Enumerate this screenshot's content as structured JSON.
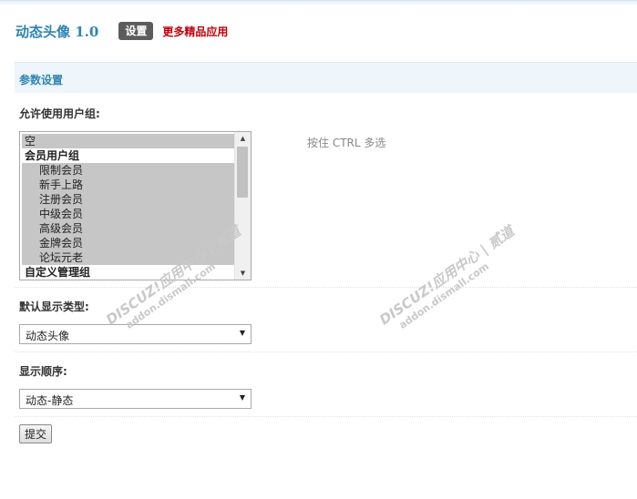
{
  "header": {
    "app_title": "动态头像 1.0",
    "settings_label": "设置",
    "more_apps_label": "更多精品应用"
  },
  "section": {
    "title": "参数设置"
  },
  "user_groups": {
    "label": "允许使用用户组:",
    "hint": "按住 CTRL 多选",
    "options": [
      {
        "text": "空",
        "group": false,
        "selected": true
      },
      {
        "text": "会员用户组",
        "group": true,
        "selected": false
      },
      {
        "text": "限制会员",
        "group": false,
        "selected": true
      },
      {
        "text": "新手上路",
        "group": false,
        "selected": true
      },
      {
        "text": "注册会员",
        "group": false,
        "selected": true
      },
      {
        "text": "中级会员",
        "group": false,
        "selected": true
      },
      {
        "text": "高级会员",
        "group": false,
        "selected": true
      },
      {
        "text": "金牌会员",
        "group": false,
        "selected": true
      },
      {
        "text": "论坛元老",
        "group": false,
        "selected": true
      },
      {
        "text": "自定义管理组",
        "group": true,
        "selected": false
      }
    ]
  },
  "display_type": {
    "label": "默认显示类型:",
    "value": "动态头像"
  },
  "display_order": {
    "label": "显示顺序:",
    "value": "动态-静态"
  },
  "submit_label": "提交",
  "watermark": {
    "main": "DISCUZ!应用中心 | 贰道",
    "sub": "addon.dismall.com",
    "reg": "®"
  },
  "colors": {
    "accent": "#2c83b5",
    "link_red": "#c3000b",
    "section_bg": "#eef6fb"
  }
}
